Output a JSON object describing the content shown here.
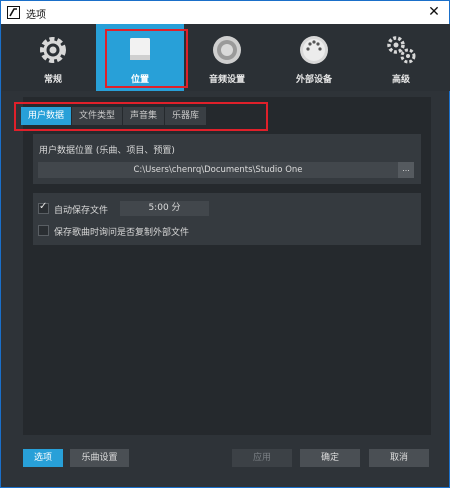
{
  "window": {
    "title": "选项",
    "close_glyph": "✕"
  },
  "toolbar": {
    "items": [
      {
        "label": "常规",
        "icon": "gear-icon"
      },
      {
        "label": "位置",
        "icon": "location-drive-icon",
        "active": true
      },
      {
        "label": "音频设置",
        "icon": "speaker-icon"
      },
      {
        "label": "外部设备",
        "icon": "midi-plug-icon"
      },
      {
        "label": "高级",
        "icon": "gears-icon"
      }
    ]
  },
  "subtabs": [
    "用户数据",
    "文件类型",
    "声音集",
    "乐器库"
  ],
  "user_data": {
    "label": "用户数据位置 (乐曲、项目、预置)",
    "path": "C:\\Users\\chenrq\\Documents\\Studio One",
    "browse": "..."
  },
  "autosave": {
    "label": "自动保存文件",
    "checked": true,
    "interval": "5:00 分"
  },
  "copy_external": {
    "label": "保存歌曲时询问是否复制外部文件",
    "checked": false
  },
  "footer": {
    "options": "选项",
    "song_settings": "乐曲设置",
    "apply": "应用",
    "ok": "确定",
    "cancel": "取消"
  },
  "colors": {
    "accent": "#28a0d8",
    "highlight": "#e0202a",
    "bg": "#2e3338"
  }
}
